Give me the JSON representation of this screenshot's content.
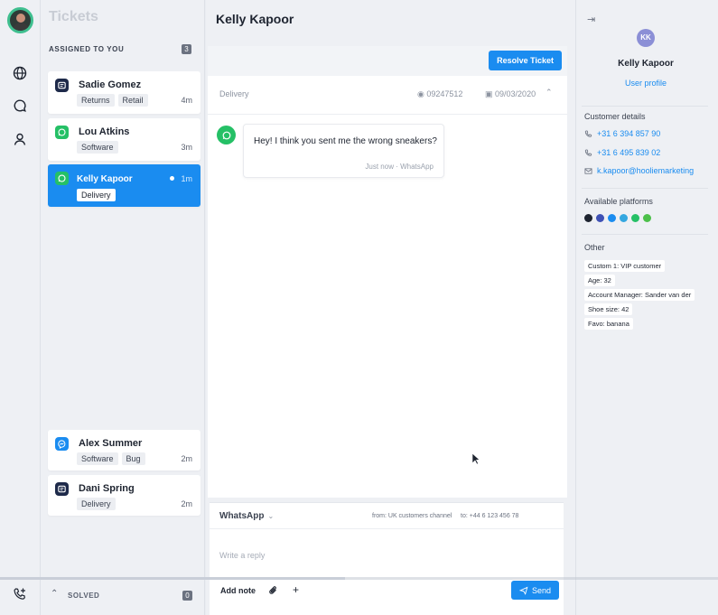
{
  "nav": {
    "icons": [
      "globe-icon",
      "chat-icon",
      "user-icon"
    ]
  },
  "list": {
    "title": "Tickets",
    "assigned_label": "ASSIGNED TO YOU",
    "assigned_count": "3",
    "tickets": [
      {
        "name": "Sadie Gomez",
        "channel": "chat",
        "tags": [
          "Returns",
          "Retail"
        ],
        "time": "4m"
      },
      {
        "name": "Lou Atkins",
        "channel": "whatsapp",
        "tags": [
          "Software"
        ],
        "time": "3m"
      },
      {
        "name": "Kelly Kapoor",
        "channel": "whatsapp",
        "tags": [
          "Delivery"
        ],
        "time": "1m",
        "active": true
      },
      {
        "name": "Alex Summer",
        "channel": "messenger",
        "tags": [
          "Software",
          "Bug"
        ],
        "time": "2m"
      },
      {
        "name": "Dani Spring",
        "channel": "chat",
        "tags": [
          "Delivery"
        ],
        "time": "2m"
      }
    ],
    "solved_label": "SOLVED",
    "solved_count": "0"
  },
  "conversation": {
    "title": "Kelly Kapoor",
    "resolve_label": "Resolve Ticket",
    "subject": "Delivery",
    "ticket_id": "09247512",
    "date": "09/03/2020",
    "message": {
      "text": "Hey! I think you sent me the wrong sneakers?",
      "meta": "Just now · WhatsApp"
    },
    "composer": {
      "channel": "WhatsApp",
      "from_to": "from: UK customers channel     to: +44 6 123 456 78",
      "placeholder": "Write a reply",
      "add_note": "Add note",
      "plus": "+",
      "send_label": "Send"
    }
  },
  "customer": {
    "initials": "KK",
    "name": "Kelly Kapoor",
    "profile_link": "User profile",
    "details_title": "Customer details",
    "phone1": "+31 6 394 857 90",
    "phone2": "+31 6 495 839 02",
    "email": "k.kapoor@hooliemarketing",
    "platforms_title": "Available platforms",
    "platform_colors": [
      "#1e2430",
      "#3f51b5",
      "#1a8cf0",
      "#34a7e0",
      "#25c066",
      "#4cc04a"
    ],
    "other_title": "Other",
    "other": [
      "Custom 1: VIP customer",
      "Age: 32",
      "Account Manager: Sander van der",
      "Shoe size: 42",
      "Favo: banana"
    ]
  },
  "video": {
    "progress": 0.48
  },
  "colors": {
    "accent": "#1a8cf0",
    "whatsapp": "#25c066"
  }
}
